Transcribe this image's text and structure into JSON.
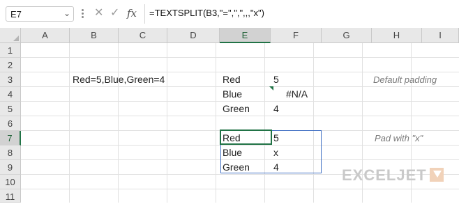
{
  "formula_bar": {
    "name_box": "E7",
    "cancel_icon": "✕",
    "enter_icon": "✓",
    "fx_label": "fx",
    "formula": "=TEXTSPLIT(B3,\"=\",\",\",,,\"x\")"
  },
  "columns": [
    "A",
    "B",
    "C",
    "D",
    "E",
    "F",
    "G",
    "H",
    "I"
  ],
  "selected_column": "E",
  "rows": [
    "1",
    "2",
    "3",
    "4",
    "5",
    "6",
    "7",
    "8",
    "9",
    "10",
    "11"
  ],
  "selected_row": "7",
  "cells": {
    "B3": "Red=5,Blue,Green=4",
    "E3": "Red",
    "F3": "5",
    "E4": "Blue",
    "F4": "#N/A",
    "E5": "Green",
    "F5": "4",
    "E7": "Red",
    "F7": "5",
    "E8": "Blue",
    "F8": "x",
    "E9": "Green",
    "F9": "4"
  },
  "notes": {
    "default_padding": "Default padding",
    "pad_with_x": "Pad with \"x\""
  },
  "logo": {
    "text": "EXCELJET"
  },
  "colors": {
    "accent": "#217346",
    "spill_border": "#4472c4",
    "logo_mark": "#f1d2b9"
  }
}
